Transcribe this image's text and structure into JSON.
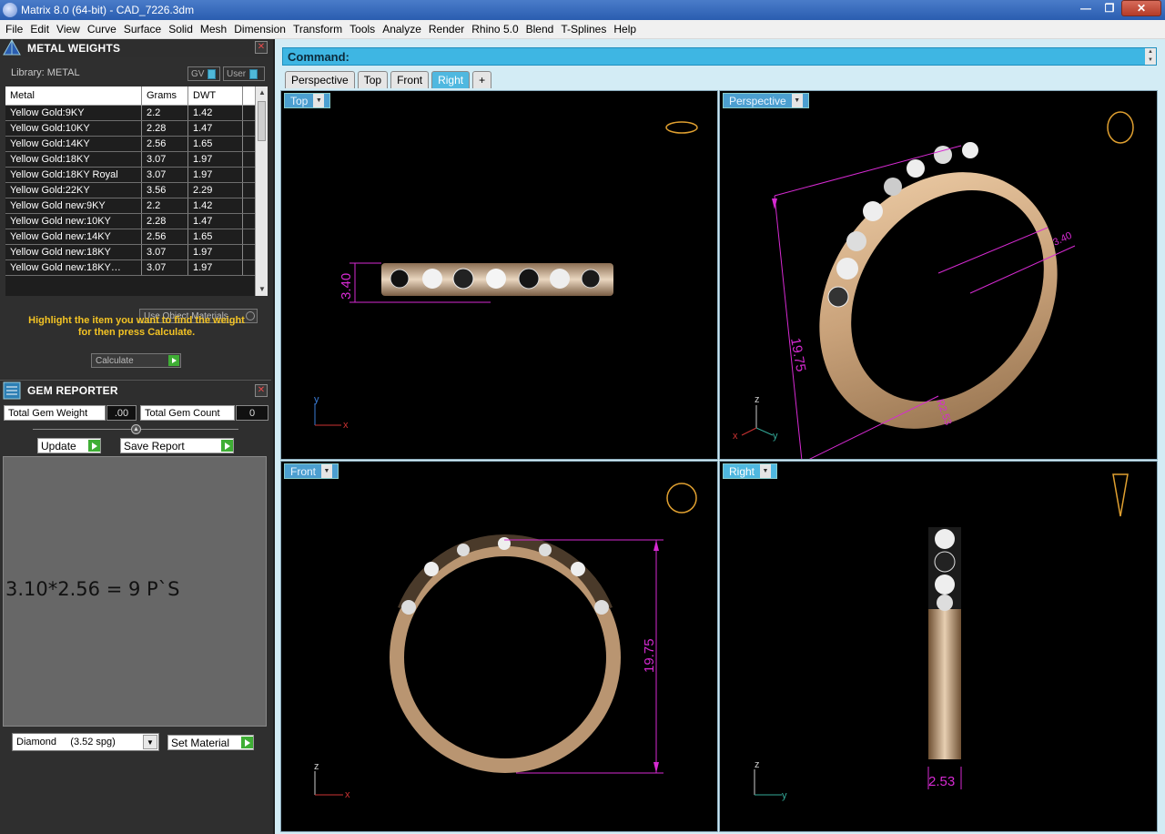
{
  "window": {
    "title": "Matrix 8.0 (64-bit) - CAD_7226.3dm"
  },
  "menu": [
    "File",
    "Edit",
    "View",
    "Curve",
    "Surface",
    "Solid",
    "Mesh",
    "Dimension",
    "Transform",
    "Tools",
    "Analyze",
    "Render",
    "Rhino 5.0",
    "Blend",
    "T-Splines",
    "Help"
  ],
  "metal_weights": {
    "title": "METAL WEIGHTS",
    "library_label": "Library: METAL",
    "gv_label": "GV",
    "user_label": "User",
    "columns": [
      "Metal",
      "Grams",
      "DWT"
    ],
    "rows": [
      [
        "Yellow Gold:9KY",
        "2.2",
        "1.42"
      ],
      [
        "Yellow Gold:10KY",
        "2.28",
        "1.47"
      ],
      [
        "Yellow Gold:14KY",
        "2.56",
        "1.65"
      ],
      [
        "Yellow Gold:18KY",
        "3.07",
        "1.97"
      ],
      [
        "Yellow Gold:18KY Royal",
        "3.07",
        "1.97"
      ],
      [
        "Yellow Gold:22KY",
        "3.56",
        "2.29"
      ],
      [
        "Yellow Gold new:9KY",
        "2.2",
        "1.42"
      ],
      [
        "Yellow Gold new:10KY",
        "2.28",
        "1.47"
      ],
      [
        "Yellow Gold new:14KY",
        "2.56",
        "1.65"
      ],
      [
        "Yellow Gold new:18KY",
        "3.07",
        "1.97"
      ],
      [
        "Yellow Gold new:18KY…",
        "3.07",
        "1.97"
      ]
    ],
    "use_object_materials": "Use Object Materials",
    "hint_line1": "Highlight the item you want to find the weight",
    "hint_line2": "for then press Calculate.",
    "calculate_label": "Calculate"
  },
  "gem_reporter": {
    "title": "GEM REPORTER",
    "total_weight_label": "Total Gem Weight",
    "total_weight_value": ".00",
    "total_count_label": "Total Gem Count",
    "total_count_value": "0",
    "update_label": "Update",
    "save_label": "Save Report",
    "report_text": "3.10*2.56 = 9 P`S",
    "material_select": "Diamond     (3.52 spg)",
    "set_material_label": "Set Material"
  },
  "command": {
    "label": "Command:"
  },
  "tabs": [
    "Perspective",
    "Top",
    "Front",
    "Right",
    "+"
  ],
  "active_tab": "Right",
  "viewports": {
    "top": {
      "label": "Top",
      "dim": "3.40",
      "axis_a": "y",
      "axis_b": "x"
    },
    "perspective": {
      "label": "Perspective",
      "dim_main": "19.75",
      "dim_side": "3.40",
      "dim_r": "R2.53",
      "axis_a": "z",
      "axis_b": "y",
      "axis_c": "x"
    },
    "front": {
      "label": "Front",
      "dim": "19.75",
      "axis_a": "z",
      "axis_b": "x"
    },
    "right": {
      "label": "Right",
      "dim": "2.53",
      "axis_a": "z",
      "axis_b": "y"
    }
  },
  "colors": {
    "accent": "#4fb8e0",
    "dimension": "#d62ad2",
    "gold": "#c9a27a",
    "hint": "#f3c324"
  }
}
